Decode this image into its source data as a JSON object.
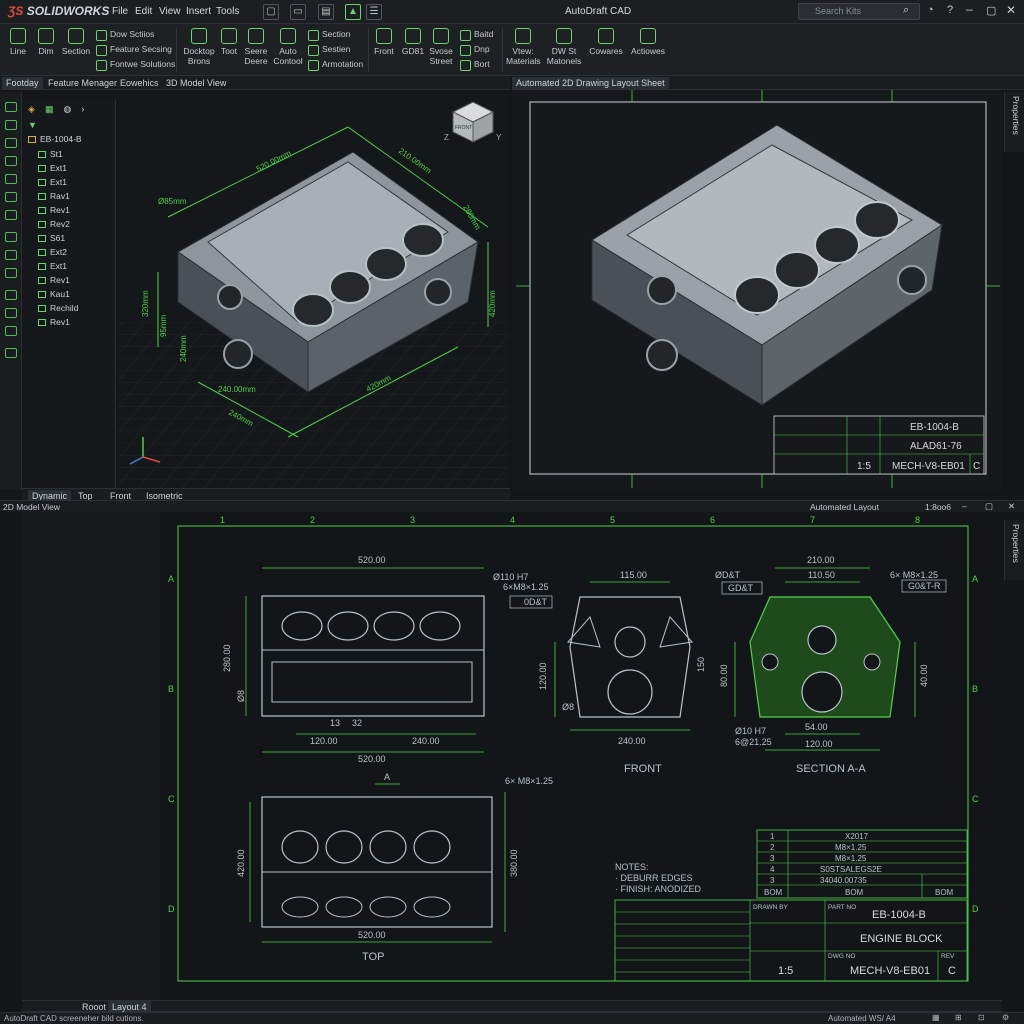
{
  "app": {
    "brand": "SOLIDWORKS",
    "title": "AutoDraft CAD"
  },
  "menu": [
    "File",
    "Edit",
    "View",
    "Insert",
    "Tools"
  ],
  "search": {
    "placeholder": "Search Kits"
  },
  "ribbon": {
    "sketch": [
      "Line",
      "Dim",
      "Section"
    ],
    "sketch_small": [
      "Dow Sctiios",
      "Feature Secsing",
      "Fontwe Solutions"
    ],
    "tools": [
      "Docktop Brons",
      "Toot",
      "Seere Deere",
      "Auto Contool"
    ],
    "annot": [
      "Section",
      "Sestien",
      "Armotation"
    ],
    "views": [
      "Front",
      "GD81",
      "Svose Street"
    ],
    "views_small": [
      "Baitd",
      "Dnp",
      "Bort"
    ],
    "more": [
      "Vtew: Materials",
      "DW St Matonels",
      "Cowares",
      "Actiowes"
    ]
  },
  "panel_tabs": [
    "Footday",
    "Feature Menager",
    "Eowehics",
    "3D Model View"
  ],
  "tree": {
    "root": "EB-1004-B",
    "items": [
      "St1",
      "Ext1",
      "Ext1",
      "Rav1",
      "Rev1",
      "Rev2",
      "S61",
      "Ext2",
      "Ext1",
      "Rev1",
      "Kau1",
      "Rechild",
      "Rev1"
    ]
  },
  "view3d": {
    "dims": [
      "520.00mm",
      "Ø85mm",
      "210.00mm",
      "280mm",
      "320mm",
      "95mm",
      "420mm",
      "420mm",
      "240.00mm",
      "240mm",
      "240mm"
    ],
    "cube": [
      "FRONT",
      "Z",
      "Y"
    ]
  },
  "view_tabs": [
    "Dynamic",
    "Top",
    "Front",
    "Isometric"
  ],
  "sheet": {
    "title": "Automated 2D Drawing Layout Sheet",
    "properties": "Properties",
    "tb": [
      "EB-1004-B",
      "ALAD61-76",
      "1:5",
      "MECH-V8-EB01",
      "C"
    ]
  },
  "layout_bar": {
    "left": "2D Model View",
    "center": "Automated Layout",
    "scale": "1:8oo6"
  },
  "drawing": {
    "props": "Properties",
    "cols": [
      "1",
      "2",
      "3",
      "4",
      "5",
      "6",
      "7",
      "8"
    ],
    "rows": [
      "A",
      "B",
      "C",
      "D"
    ],
    "top_dims": [
      "520.00",
      "Ø110 H7",
      "6×M8×1.25",
      "0D&T",
      "280.00",
      "Ø8",
      "13",
      "32",
      "120.00",
      "240.00",
      "520.00"
    ],
    "front_dims": [
      "115.00",
      "240.00",
      "120.00",
      "Ø8",
      "150"
    ],
    "front_label": "FRONT",
    "section_dims": [
      "210.00",
      "6× M8×1.25",
      "110.50",
      "GD&T",
      "ØD&T",
      "G0&T-R",
      "Ø10 H7",
      "6@21.25",
      "54.00",
      "120.00",
      "80.00",
      "40.00"
    ],
    "section_label": "SECTION A-A",
    "topv_dims": [
      "A",
      "6× M8×1.25",
      "420.00",
      "380.00",
      "520.00"
    ],
    "top_label": "TOP",
    "notes": [
      "NOTES:",
      "· DEBURR EDGES",
      "· FINISH: ANODIZED"
    ],
    "bom": [
      [
        "1",
        "X2017"
      ],
      [
        "2",
        "M8×1.25"
      ],
      [
        "3",
        "M8×1.25"
      ],
      [
        "4",
        "S0STSALEGS2E"
      ],
      [
        "3",
        "34040.00735"
      ],
      [
        "BOM",
        "BOM",
        "BOM"
      ]
    ],
    "tb": {
      "part": "EB-1004-B",
      "partno": "PART NO",
      "name": "ENGINE BLOCK",
      "scale": "1:5",
      "dwg": "MECH-V8-EB01",
      "rev": "C",
      "drawn": "DRAWN BY",
      "rev_label": "REV",
      "dwg_label": "DWG NO"
    }
  },
  "sheet_tabs": [
    "Rooot",
    "Layout 4"
  ],
  "status": {
    "left": "AutoDraft CAD  screeneher bild cutions.",
    "right": "Automated WS/ A4"
  },
  "colors": {
    "accent": "#52d04a",
    "bg": "#131618",
    "line": "#b9c2c8"
  }
}
